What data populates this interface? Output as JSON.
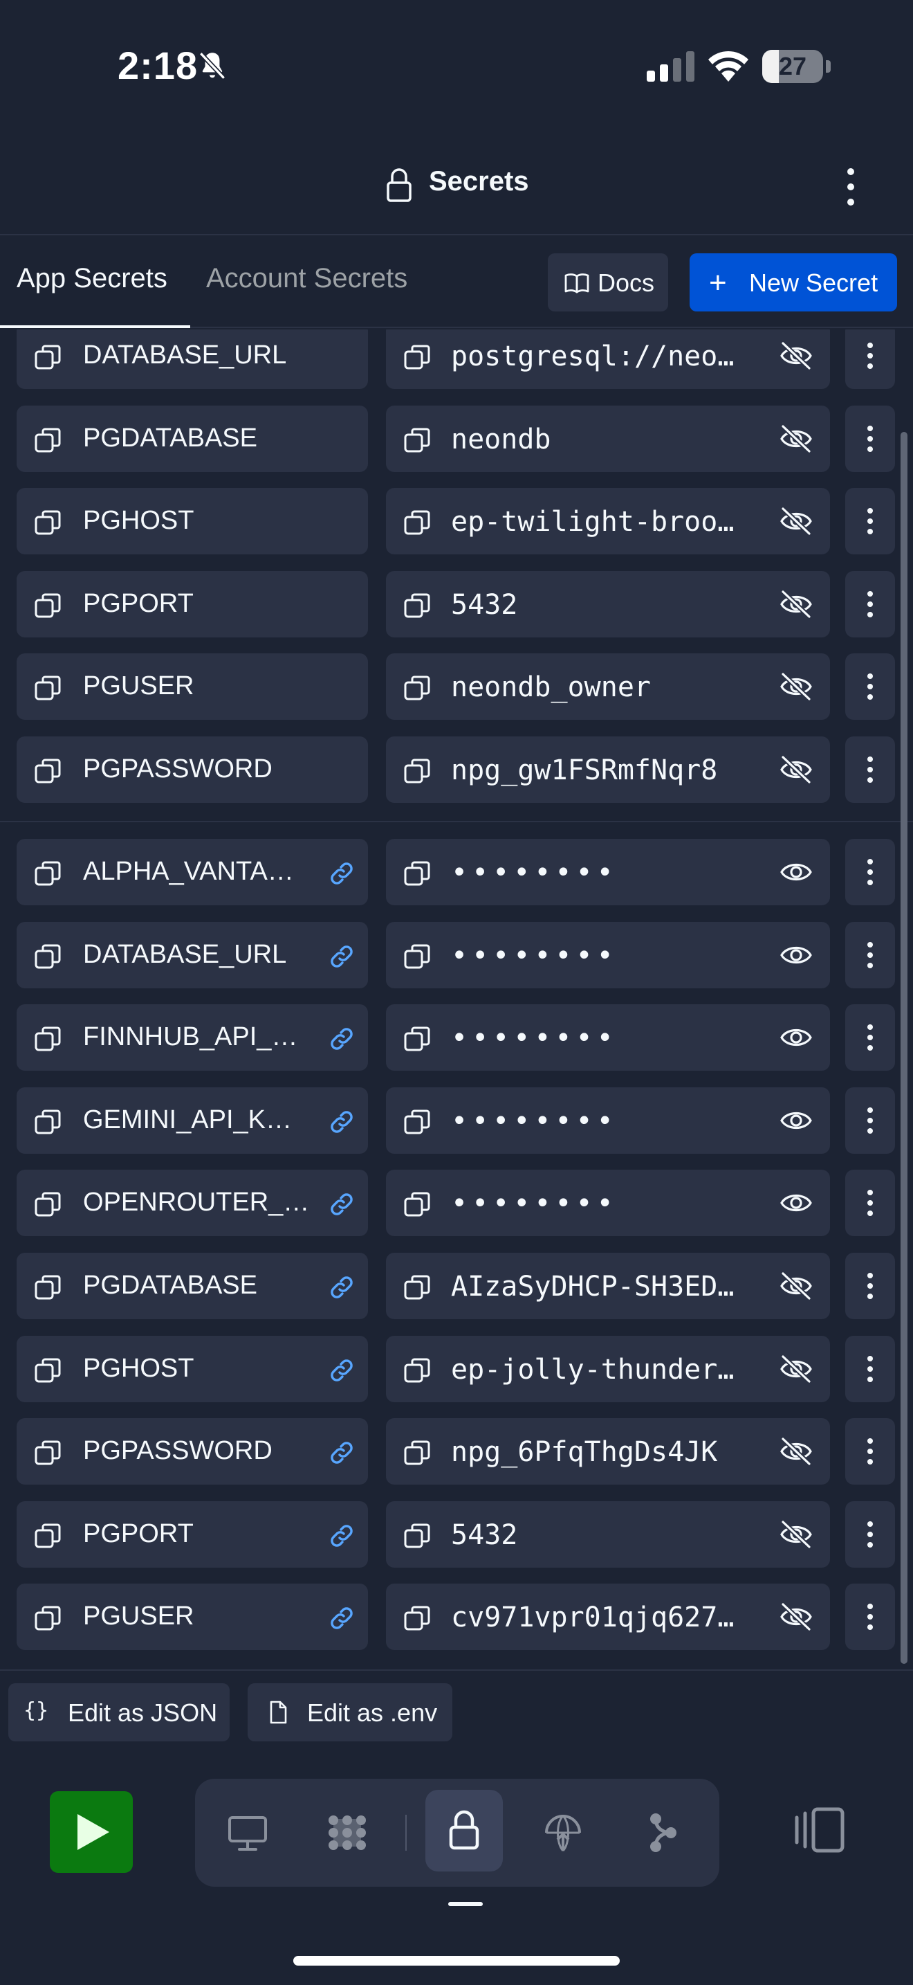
{
  "status_bar": {
    "time": "2:18",
    "battery_level": "27",
    "battery_fraction": 0.27
  },
  "header": {
    "title": "Secrets"
  },
  "tabs": [
    {
      "label": "App Secrets",
      "active": true
    },
    {
      "label": "Account Secrets",
      "active": false
    }
  ],
  "actions": {
    "docs_label": "Docs",
    "new_secret_label": "New Secret"
  },
  "app_secrets": [
    {
      "key": "DATABASE_URL",
      "value": "postgresql://neo…",
      "visible": true
    },
    {
      "key": "PGDATABASE",
      "value": "neondb",
      "visible": true
    },
    {
      "key": "PGHOST",
      "value": "ep-twilight-broo…",
      "visible": true
    },
    {
      "key": "PGPORT",
      "value": "5432",
      "visible": true
    },
    {
      "key": "PGUSER",
      "value": "neondb_owner",
      "visible": true
    },
    {
      "key": "PGPASSWORD",
      "value": "npg_gw1FSRmfNqr8",
      "visible": true
    }
  ],
  "linked_secrets": [
    {
      "key": "ALPHA_VANTA…",
      "value": "••••••••",
      "visible": false
    },
    {
      "key": "DATABASE_URL",
      "value": "••••••••",
      "visible": false
    },
    {
      "key": "FINNHUB_API_…",
      "value": "••••••••",
      "visible": false
    },
    {
      "key": "GEMINI_API_K…",
      "value": "••••••••",
      "visible": false
    },
    {
      "key": "OPENROUTER_…",
      "value": "••••••••",
      "visible": false
    },
    {
      "key": "PGDATABASE",
      "value": "AIzaSyDHCP-SH3ED…",
      "visible": true
    },
    {
      "key": "PGHOST",
      "value": "ep-jolly-thunder…",
      "visible": true
    },
    {
      "key": "PGPASSWORD",
      "value": "npg_6PfqThgDs4JK",
      "visible": true
    },
    {
      "key": "PGPORT",
      "value": "5432",
      "visible": true
    },
    {
      "key": "PGUSER",
      "value": "cv971vpr01qjq627…",
      "visible": true
    }
  ],
  "edit_bar": {
    "json_label": "Edit as JSON",
    "json_icon": "{}",
    "env_label": "Edit as .env"
  },
  "toolbar": {
    "items": [
      "run-icon",
      "desktop-icon",
      "workflow-icon",
      "lock-icon",
      "globe-deploy-icon",
      "git-branch-icon",
      "layout-toggle-icon"
    ],
    "active": "lock-icon"
  },
  "colors": {
    "background": "#1c2333",
    "surface": "#2b3245",
    "primary": "#0053d6",
    "run": "#0b7a10",
    "link": "#58a6ff"
  }
}
